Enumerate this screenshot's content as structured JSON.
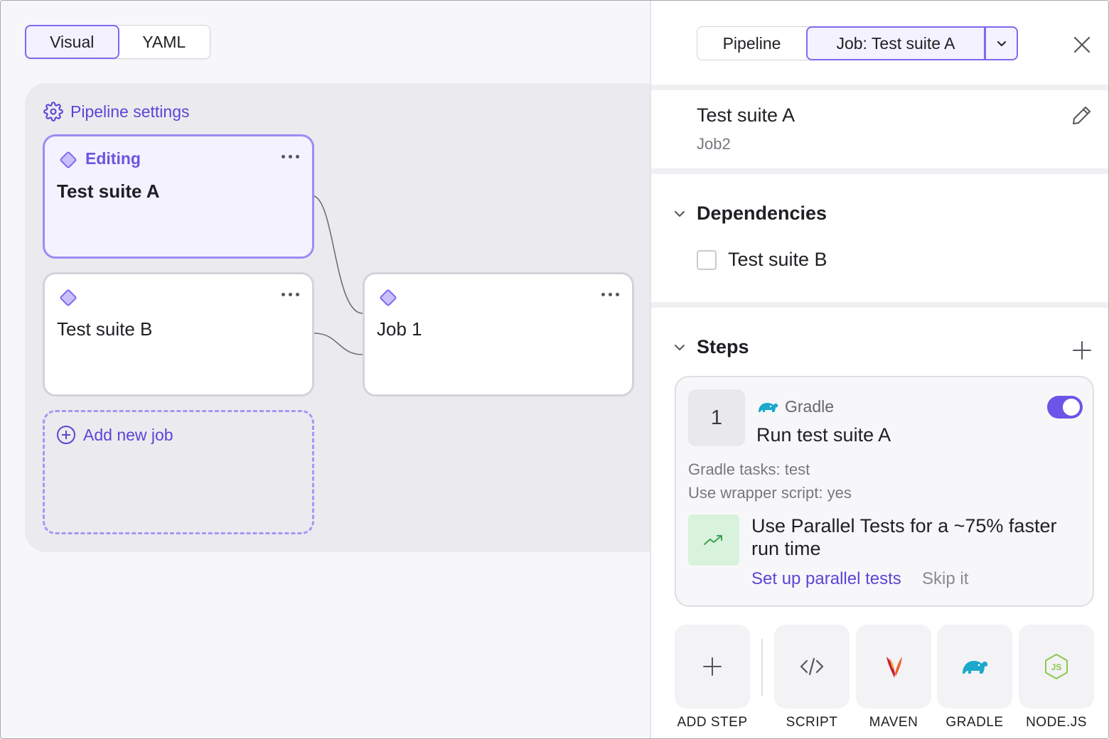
{
  "view_toggle": {
    "visual": "Visual",
    "yaml": "YAML",
    "selected": "Visual"
  },
  "pipeline": {
    "settings_label": "Pipeline settings",
    "jobs": [
      {
        "status": "Editing",
        "title": "Test suite A"
      },
      {
        "status": "",
        "title": "Test suite B"
      },
      {
        "status": "",
        "title": "Job 1"
      }
    ],
    "add_job_label": "Add new job"
  },
  "panel": {
    "tabs": {
      "pipeline": "Pipeline",
      "job": "Job: Test suite A"
    },
    "job_name": "Test suite A",
    "job_id": "Job2",
    "dependencies": {
      "heading": "Dependencies",
      "items": [
        {
          "label": "Test suite B",
          "checked": false
        }
      ]
    },
    "steps": {
      "heading": "Steps",
      "items": [
        {
          "number": "1",
          "type": "Gradle",
          "title": "Run test suite A",
          "enabled": true,
          "details": [
            "Gradle tasks: test",
            "Use wrapper script: yes"
          ],
          "hint": {
            "text": "Use Parallel Tests for a ~75% faster run time",
            "action": "Set up parallel tests",
            "dismiss": "Skip it"
          }
        }
      ]
    },
    "add_step_buttons": [
      {
        "label": "ADD STEP",
        "icon": "plus-icon"
      },
      {
        "label": "SCRIPT",
        "icon": "code-icon"
      },
      {
        "label": "MAVEN",
        "icon": "maven-feather-icon"
      },
      {
        "label": "GRADLE",
        "icon": "gradle-elephant-icon"
      },
      {
        "label": "NODE.JS",
        "icon": "nodejs-icon"
      }
    ]
  },
  "colors": {
    "accent": "#6b55e8",
    "accent_light": "#f4f2ff",
    "canvas": "#ebebef",
    "gradle": "#1ba8cb",
    "hint_bg": "#d9f2dc",
    "node": "#8cc84b"
  }
}
